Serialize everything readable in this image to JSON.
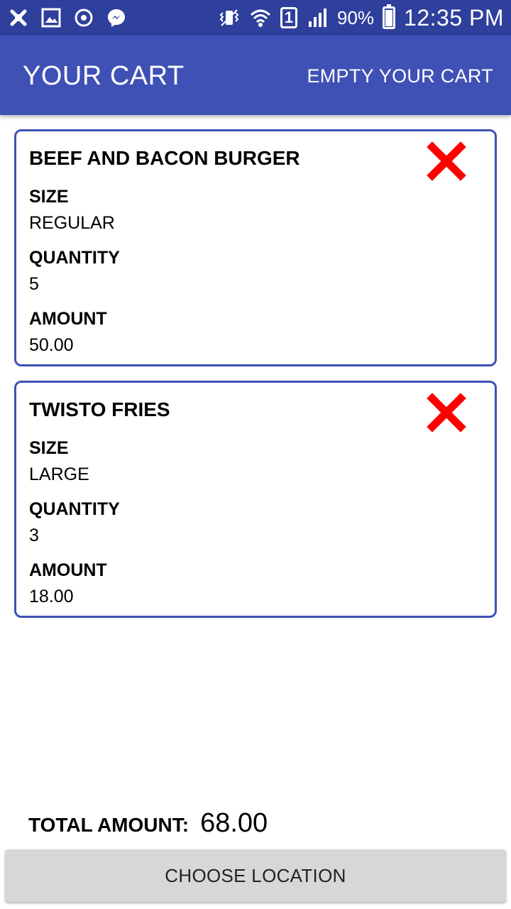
{
  "status_bar": {
    "battery_percent": "90%",
    "time": "12:35 PM",
    "sim_slot": "1",
    "icons_left": [
      "app-icon",
      "gallery-icon",
      "sync-icon",
      "messenger-icon"
    ],
    "icons_right": [
      "vibrate-icon",
      "wifi-icon",
      "sim-icon",
      "signal-icon",
      "battery-icon"
    ]
  },
  "app_bar": {
    "title": "YOUR CART",
    "action": "EMPTY YOUR CART"
  },
  "cart": {
    "items": [
      {
        "name": "BEEF AND BACON BURGER",
        "size_label": "SIZE",
        "size": "REGULAR",
        "quantity_label": "QUANTITY",
        "quantity": "5",
        "amount_label": "AMOUNT",
        "amount": "50.00"
      },
      {
        "name": "TWISTO FRIES",
        "size_label": "SIZE",
        "size": "LARGE",
        "quantity_label": "QUANTITY",
        "quantity": "3",
        "amount_label": "AMOUNT",
        "amount": "18.00"
      }
    ]
  },
  "footer": {
    "total_label": "TOTAL AMOUNT:",
    "total_value": "68.00",
    "button_label": "CHOOSE LOCATION"
  },
  "colors": {
    "status_bar": "#2f3f9c",
    "app_bar": "#3f51b5",
    "card_border": "#3f51b5",
    "remove_icon": "#ff0000",
    "button_bg": "#d6d7d7"
  }
}
